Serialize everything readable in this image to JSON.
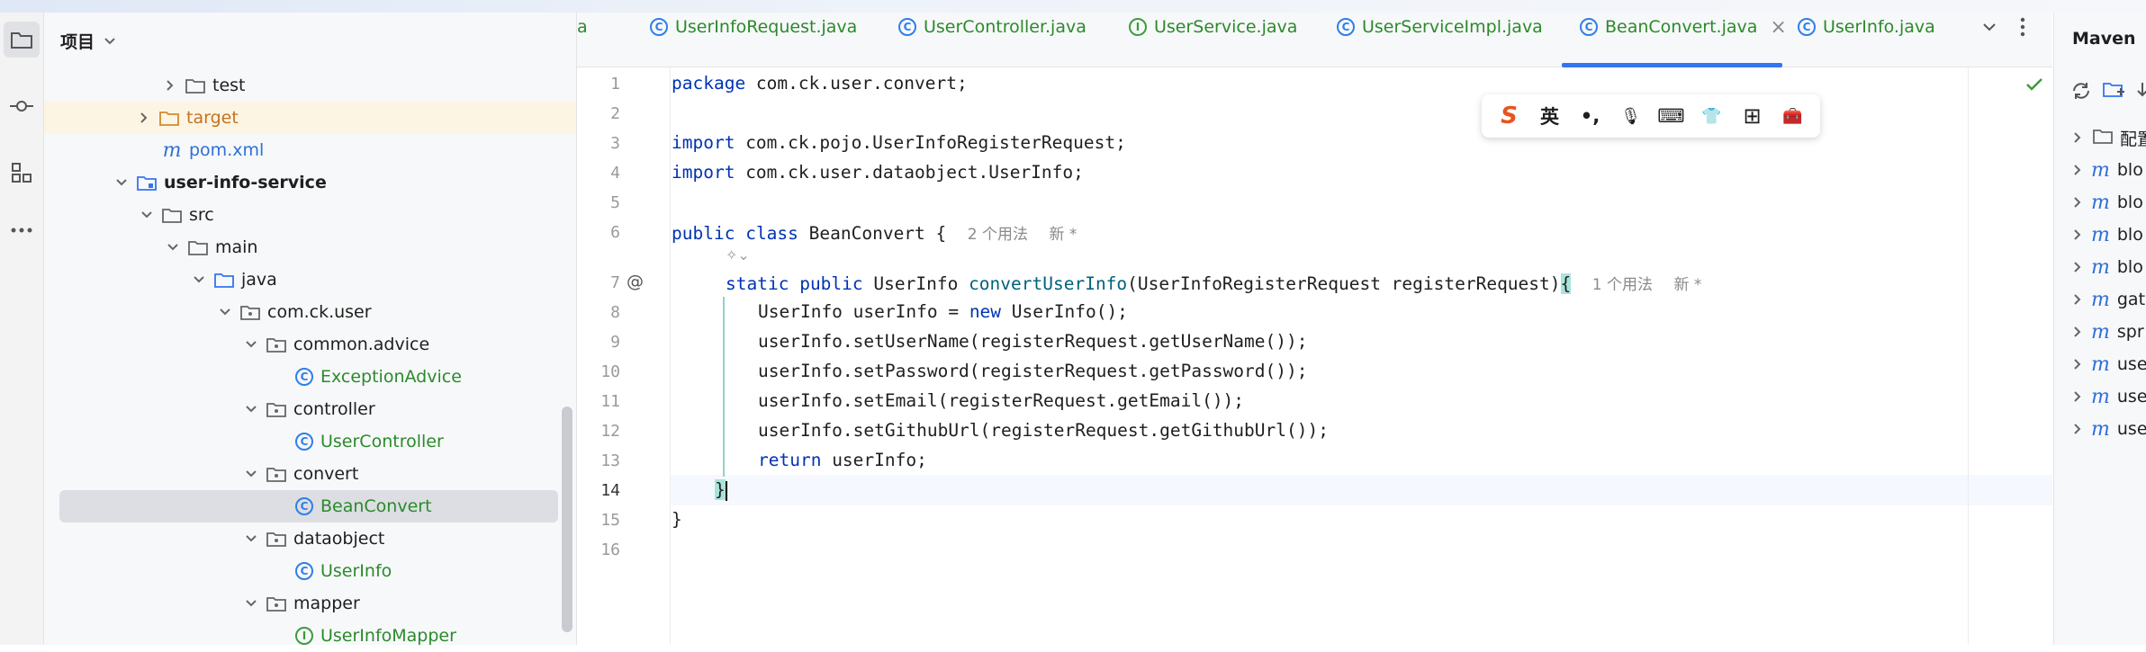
{
  "project_panel": {
    "title": "项目",
    "tree": [
      {
        "label": "test",
        "kind": "folder",
        "indent": 0
      },
      {
        "label": "target",
        "kind": "folder-excluded",
        "indent": 0
      },
      {
        "label": "pom.xml",
        "kind": "maven",
        "indent": 0
      },
      {
        "label": "user-info-service",
        "kind": "module",
        "indent": 0
      },
      {
        "label": "src",
        "kind": "folder",
        "indent": 0
      },
      {
        "label": "main",
        "kind": "folder",
        "indent": 0
      },
      {
        "label": "java",
        "kind": "source-folder",
        "indent": 0
      },
      {
        "label": "com.ck.user",
        "kind": "package",
        "indent": 0
      },
      {
        "label": "common.advice",
        "kind": "package",
        "indent": 0
      },
      {
        "label": "ExceptionAdvice",
        "kind": "class",
        "indent": 0
      },
      {
        "label": "controller",
        "kind": "package",
        "indent": 0
      },
      {
        "label": "UserController",
        "kind": "class",
        "indent": 0
      },
      {
        "label": "convert",
        "kind": "package",
        "indent": 0
      },
      {
        "label": "BeanConvert",
        "kind": "class",
        "indent": 0
      },
      {
        "label": "dataobject",
        "kind": "package",
        "indent": 0
      },
      {
        "label": "UserInfo",
        "kind": "class",
        "indent": 0
      },
      {
        "label": "mapper",
        "kind": "package",
        "indent": 0
      },
      {
        "label": "UserInfoMapper",
        "kind": "interface",
        "indent": 0
      }
    ]
  },
  "tabs": [
    {
      "label": "a",
      "type": "partial"
    },
    {
      "label": "UserInfoRequest.java",
      "type": "class"
    },
    {
      "label": "UserController.java",
      "type": "class"
    },
    {
      "label": "UserService.java",
      "type": "interface"
    },
    {
      "label": "UserServiceImpl.java",
      "type": "class"
    },
    {
      "label": "BeanConvert.java",
      "type": "class",
      "active": true
    },
    {
      "label": "UserInfo.java",
      "type": "class"
    }
  ],
  "tab_close": "×",
  "editor": {
    "line_numbers": [
      "1",
      "2",
      "3",
      "4",
      "5",
      "6",
      "7",
      "8",
      "9",
      "10",
      "11",
      "12",
      "13",
      "14",
      "15",
      "16"
    ],
    "line1": {
      "kw": "package",
      "rest": " com.ck.user.convert;"
    },
    "line3": {
      "kw": "import",
      "rest": " com.ck.pojo.UserInfoRegisterRequest;"
    },
    "line4": {
      "kw": "import",
      "rest": " com.ck.user.dataobject.UserInfo;"
    },
    "line6": {
      "kw1": "public",
      "kw2": "class",
      "rest": " BeanConvert {",
      "hint1": "2 个用法",
      "hint2": "新 *"
    },
    "ai_hint": "✧⌄",
    "line7": {
      "kw1": "static",
      "kw2": "public",
      "type": " UserInfo ",
      "fn": "convertUserInfo",
      "params": "(UserInfoRegisterRequest registerRequest)",
      "brace": "{",
      "hint1": "1 个用法",
      "hint2": "新 *"
    },
    "line8": {
      "a": "UserInfo userInfo = ",
      "kw": "new",
      "b": " UserInfo();"
    },
    "line9": "userInfo.setUserName(registerRequest.getUserName());",
    "line10": "userInfo.setPassword(registerRequest.getPassword());",
    "line11": "userInfo.setEmail(registerRequest.getEmail());",
    "line12": "userInfo.setGithubUrl(registerRequest.getGithubUrl());",
    "line13": {
      "kw": "return",
      "rest": " userInfo;"
    },
    "line14": "}",
    "line15": "}",
    "gutter_at": "@"
  },
  "ime_toolbar": {
    "logo": "S",
    "lang": "英",
    "punct": "•,",
    "mic": "🎙",
    "keyboard": "⌨",
    "skin": "👕",
    "grid": "⊞",
    "tools": "🧰"
  },
  "maven": {
    "title": "Maven",
    "items": [
      {
        "prefix": "",
        "label": "配置"
      },
      {
        "prefix": "m",
        "label": "blo"
      },
      {
        "prefix": "m",
        "label": "blo"
      },
      {
        "prefix": "m",
        "label": "blo"
      },
      {
        "prefix": "m",
        "label": "blo"
      },
      {
        "prefix": "m",
        "label": "gat"
      },
      {
        "prefix": "m",
        "label": "spr"
      },
      {
        "prefix": "m",
        "label": "use"
      },
      {
        "prefix": "m",
        "label": "use"
      },
      {
        "prefix": "m",
        "label": "use"
      }
    ]
  },
  "colors": {
    "accent": "#3574f0",
    "class_green": "#2b8a2b",
    "keyword": "#0033b3",
    "method": "#00627a"
  }
}
